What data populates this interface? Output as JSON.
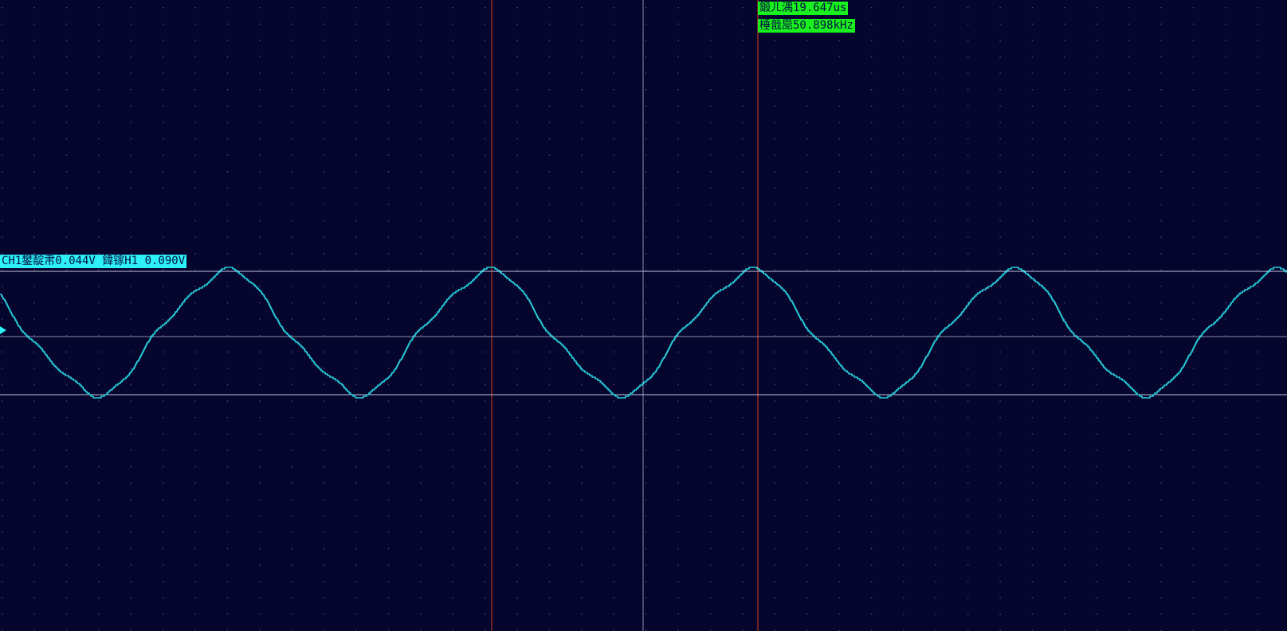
{
  "readouts": {
    "delta_time": "鍛ㄦ湡19.647us",
    "frequency": "棰戠巼50.898kHz",
    "ch1_amplitude": "CH1鐢靛帇0.044V  鍏镓H1 0.090V"
  },
  "colors": {
    "background": "#05052e",
    "grid_dot": "#4a4a78",
    "trace": "#2ef0f7",
    "time_cursor": "#e0401a",
    "center_line": "#8a8aa6",
    "level_line": "#c8c8e0",
    "readout_green": "#19f01e",
    "readout_cyan": "#2ef0f7"
  },
  "chart_data": {
    "type": "line",
    "title": "",
    "xlabel": "",
    "ylabel": "",
    "series": [
      {
        "waveform": "sine-with-ripple",
        "cycles_visible": 4.9,
        "period_us": 19.647,
        "frequency_khz": 50.898
      }
    ]
  }
}
